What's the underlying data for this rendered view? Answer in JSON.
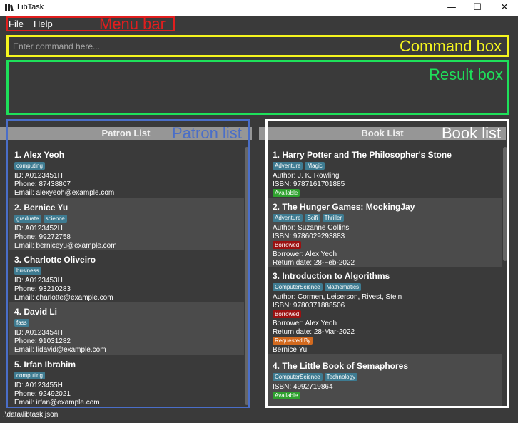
{
  "window": {
    "title": "LibTask",
    "minimize_glyph": "—",
    "maximize_glyph": "☐",
    "close_glyph": "✕",
    "app_icon": "libtask-app-icon"
  },
  "menu": {
    "file": "File",
    "help": "Help"
  },
  "command": {
    "placeholder": "Enter command here..."
  },
  "annotations": {
    "menu_bar": "Menu bar",
    "command_box": "Command box",
    "result_box": "Result box",
    "patron_list": "Patron list",
    "book_list": "Book list"
  },
  "annotation_colors": {
    "menu_bar": "#e01e1e",
    "command_box": "#f5f51e",
    "result_box": "#1ee05a",
    "patron_list": "#4a6ec8",
    "book_list": "#ffffff"
  },
  "patron_list": {
    "header": "Patron List",
    "patrons": [
      {
        "name": "1.  Alex Yeoh",
        "tags": [
          "computing"
        ],
        "id": "ID: A0123451H",
        "phone": "Phone: 87438807",
        "email": "Email: alexyeoh@example.com"
      },
      {
        "name": "2.  Bernice Yu",
        "tags": [
          "graduate",
          "science"
        ],
        "id": "ID: A0123452H",
        "phone": "Phone: 99272758",
        "email": "Email: berniceyu@example.com"
      },
      {
        "name": "3.  Charlotte Oliveiro",
        "tags": [
          "business"
        ],
        "id": "ID: A0123453H",
        "phone": "Phone: 93210283",
        "email": "Email: charlotte@example.com"
      },
      {
        "name": "4.  David Li",
        "tags": [
          "fass"
        ],
        "id": "ID: A0123454H",
        "phone": "Phone: 91031282",
        "email": "Email: lidavid@example.com"
      },
      {
        "name": "5.  Irfan Ibrahim",
        "tags": [
          "computing"
        ],
        "id": "ID: A0123455H",
        "phone": "Phone: 92492021",
        "email": "Email: irfan@example.com"
      }
    ]
  },
  "book_list": {
    "header": "Book List",
    "books": [
      {
        "title": "1.  Harry Potter and The Philosopher's Stone",
        "tags": [
          "Adventure",
          "Magic"
        ],
        "author": "Author: J. K. Rowling",
        "isbn": "ISBN: 9787161701885",
        "status": "Available"
      },
      {
        "title": "2.  The Hunger Games: MockingJay",
        "tags": [
          "Adventure",
          "Scifi",
          "Thriller"
        ],
        "author": "Author: Suzanne Collins",
        "isbn": "ISBN: 9786029293883",
        "status": "Borrowed",
        "borrower": "Borrower: Alex Yeoh",
        "return_date": "Return date: 28-Feb-2022"
      },
      {
        "title": "3.  Introduction to Algorithms",
        "tags": [
          "ComputerScience",
          "Mathematics"
        ],
        "author": "Author: Cormen, Leiserson, Rivest, Stein",
        "isbn": "ISBN: 9780371888506",
        "status": "Borrowed",
        "borrower": "Borrower: Alex Yeoh",
        "return_date": "Return date: 28-Mar-2022",
        "request_label": "Requested By",
        "requester": "Bernice Yu"
      },
      {
        "title": "4.  The Little Book of Semaphores",
        "tags": [
          "ComputerScience",
          "Technology"
        ],
        "isbn": "ISBN: 4992719864",
        "status": "Available"
      }
    ]
  },
  "status_colors": {
    "Available": "#2ea12e",
    "Borrowed": "#9b1111",
    "Requested By": "#d2691e"
  },
  "status_bar": {
    "path": ".\\data\\libtask.json"
  }
}
